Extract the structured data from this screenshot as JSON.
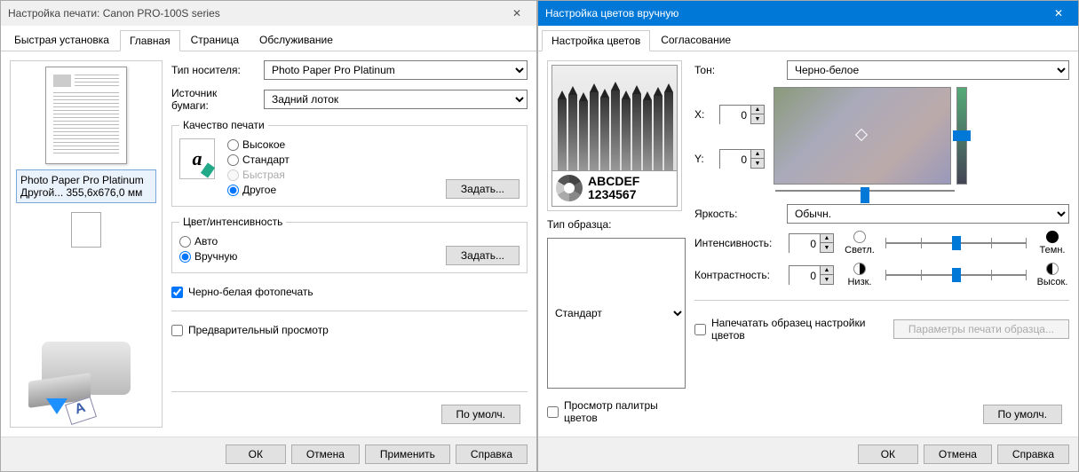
{
  "left": {
    "title": "Настройка печати: Canon PRO-100S series",
    "tabs": [
      "Быстрая установка",
      "Главная",
      "Страница",
      "Обслуживание"
    ],
    "active_tab": 1,
    "media_label": "Тип носителя:",
    "media_value": "Photo Paper Pro Platinum",
    "source_label": "Источник бумаги:",
    "source_value": "Задний лоток",
    "quality_legend": "Качество печати",
    "quality_options": [
      "Высокое",
      "Стандарт",
      "Быстрая",
      "Другое"
    ],
    "quality_selected": 3,
    "quality_disabled": 2,
    "set_btn": "Задать...",
    "color_legend": "Цвет/интенсивность",
    "color_options": [
      "Авто",
      "Вручную"
    ],
    "color_selected": 1,
    "bw_label": "Черно-белая фотопечать",
    "bw_checked": true,
    "preview_label": "Предварительный просмотр",
    "preview_checked": false,
    "defaults_btn": "По умолч.",
    "paper_info1": "Photo Paper Pro Platinum",
    "paper_info2": "Другой... 355,6x676,0 мм",
    "footer": [
      "ОК",
      "Отмена",
      "Применить",
      "Справка"
    ]
  },
  "right": {
    "title": "Настройка цветов вручную",
    "tabs": [
      "Настройка цветов",
      "Согласование"
    ],
    "active_tab": 0,
    "tone_label": "Тон:",
    "tone_value": "Черно-белое",
    "x_label": "X:",
    "x_value": 0,
    "y_label": "Y:",
    "y_value": 0,
    "sample_abc": "ABCDEF",
    "sample_num": "1234567",
    "sample_type_label": "Тип образца:",
    "sample_type_value": "Стандарт",
    "palette_label": "Просмотр палитры цветов",
    "palette_checked": false,
    "brightness_label": "Яркость:",
    "brightness_value": "Обычн.",
    "intensity_label": "Интенсивность:",
    "intensity_value": 0,
    "intensity_left": "Светл.",
    "intensity_right": "Темн.",
    "contrast_label": "Контрастность:",
    "contrast_value": 0,
    "contrast_left": "Низк.",
    "contrast_right": "Высок.",
    "print_pattern_label": "Напечатать образец настройки цветов",
    "print_pattern_checked": false,
    "pattern_params_btn": "Параметры печати образца...",
    "defaults_btn": "По умолч.",
    "footer": [
      "ОК",
      "Отмена",
      "Справка"
    ]
  }
}
